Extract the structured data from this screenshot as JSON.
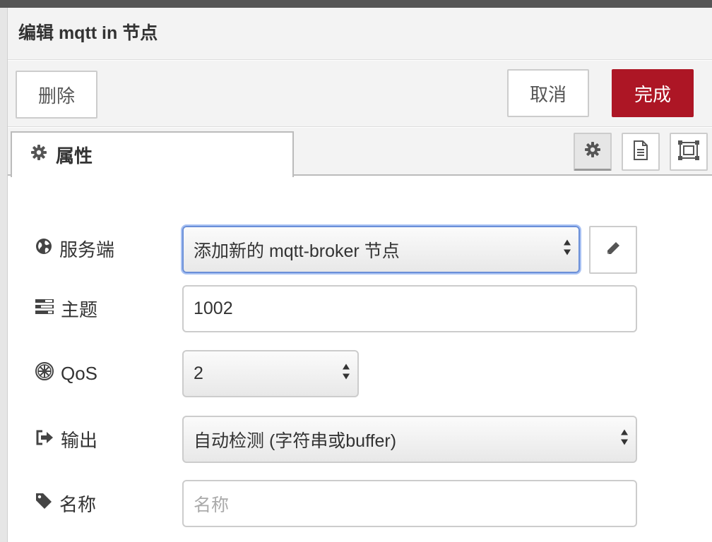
{
  "header": {
    "title": "编辑 mqtt in 节点"
  },
  "toolbar": {
    "delete_label": "删除",
    "cancel_label": "取消",
    "done_label": "完成"
  },
  "tabs": {
    "properties_label": "属性"
  },
  "form": {
    "server": {
      "label": "服务端",
      "value": "添加新的 mqtt-broker 节点",
      "icon": "globe-icon"
    },
    "topic": {
      "label": "主题",
      "value": "1002",
      "icon": "tasks-icon"
    },
    "qos": {
      "label": "QoS",
      "value": "2",
      "icon": "empire-icon"
    },
    "output": {
      "label": "输出",
      "value": "自动检测 (字符串或buffer)",
      "icon": "sign-out-icon"
    },
    "name": {
      "label": "名称",
      "value": "",
      "placeholder": "名称",
      "icon": "tag-icon"
    }
  },
  "colors": {
    "primary": "#ad1625",
    "focus_border": "#6a8fd8"
  }
}
